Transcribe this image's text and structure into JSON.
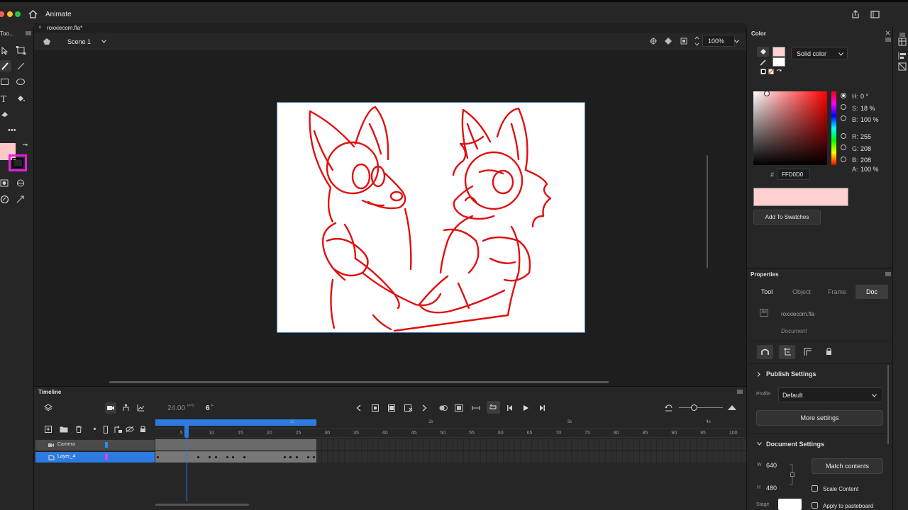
{
  "app": {
    "title": "Animate"
  },
  "document": {
    "tab_label": "roxxiecom.fla*",
    "scene": "Scene 1",
    "zoom": "100%"
  },
  "timeline": {
    "panel_title": "Timeline",
    "fps": "24.00",
    "fps_unit": "FPS",
    "current_frame": "6",
    "frame_unit": "F",
    "ruler_ticks": [
      "5",
      "10",
      "15",
      "20",
      "25",
      "30",
      "35",
      "40",
      "45",
      "50",
      "55",
      "60",
      "65",
      "70",
      "75",
      "80",
      "85",
      "90",
      "95",
      "100"
    ],
    "second_marks": [
      "1s",
      "2s",
      "3s",
      "4s"
    ],
    "layers": [
      {
        "name": "Camera",
        "color": "#2a8cff",
        "selected": false
      },
      {
        "name": "Layer_4",
        "color": "#e040e0",
        "selected": true
      }
    ]
  },
  "color_panel": {
    "title": "Color",
    "fill_type": "Solid color",
    "hsb": {
      "h_label": "H:",
      "h_value": "0 °",
      "s_label": "S:",
      "s_value": "18 %",
      "b_label": "B:",
      "b_value": "100 %"
    },
    "rgb": {
      "r_label": "R:",
      "r_value": "255",
      "g_label": "G:",
      "g_value": "208",
      "b_label": "B:",
      "b_value": "208"
    },
    "alpha": {
      "label": "A:",
      "value": "100 %"
    },
    "hash": "#",
    "hex": "FFD0D0",
    "add_swatch": "Add To Swatches",
    "fill_color": "#ffd0d0",
    "stroke_color": "#ffffff"
  },
  "properties": {
    "title": "Properties",
    "tabs": [
      "Tool",
      "Object",
      "Frame",
      "Doc"
    ],
    "active_tab": "Doc",
    "doc_badge": "An",
    "doc_name": "roxxiecom.fla",
    "doc_type": "Document",
    "publish": {
      "header": "Publish Settings",
      "profile_label": "Profile",
      "profile_value": "Default",
      "more_button": "More settings"
    },
    "doc_settings": {
      "header": "Document Settings",
      "w_label": "W",
      "w_value": "640",
      "h_label": "H",
      "h_value": "480",
      "match_button": "Match contents",
      "scale_content": "Scale Content",
      "stage_label": "Stage",
      "apply_pasteboard": "Apply to pasteboard"
    }
  },
  "toolbar": {
    "left_panel_title": "Too...",
    "fill_swatch": "#ffc8c8",
    "stroke_swatch": "#e020e0"
  },
  "colors": {
    "accent": "#2d7be0",
    "stroke_red": "#e01010"
  }
}
